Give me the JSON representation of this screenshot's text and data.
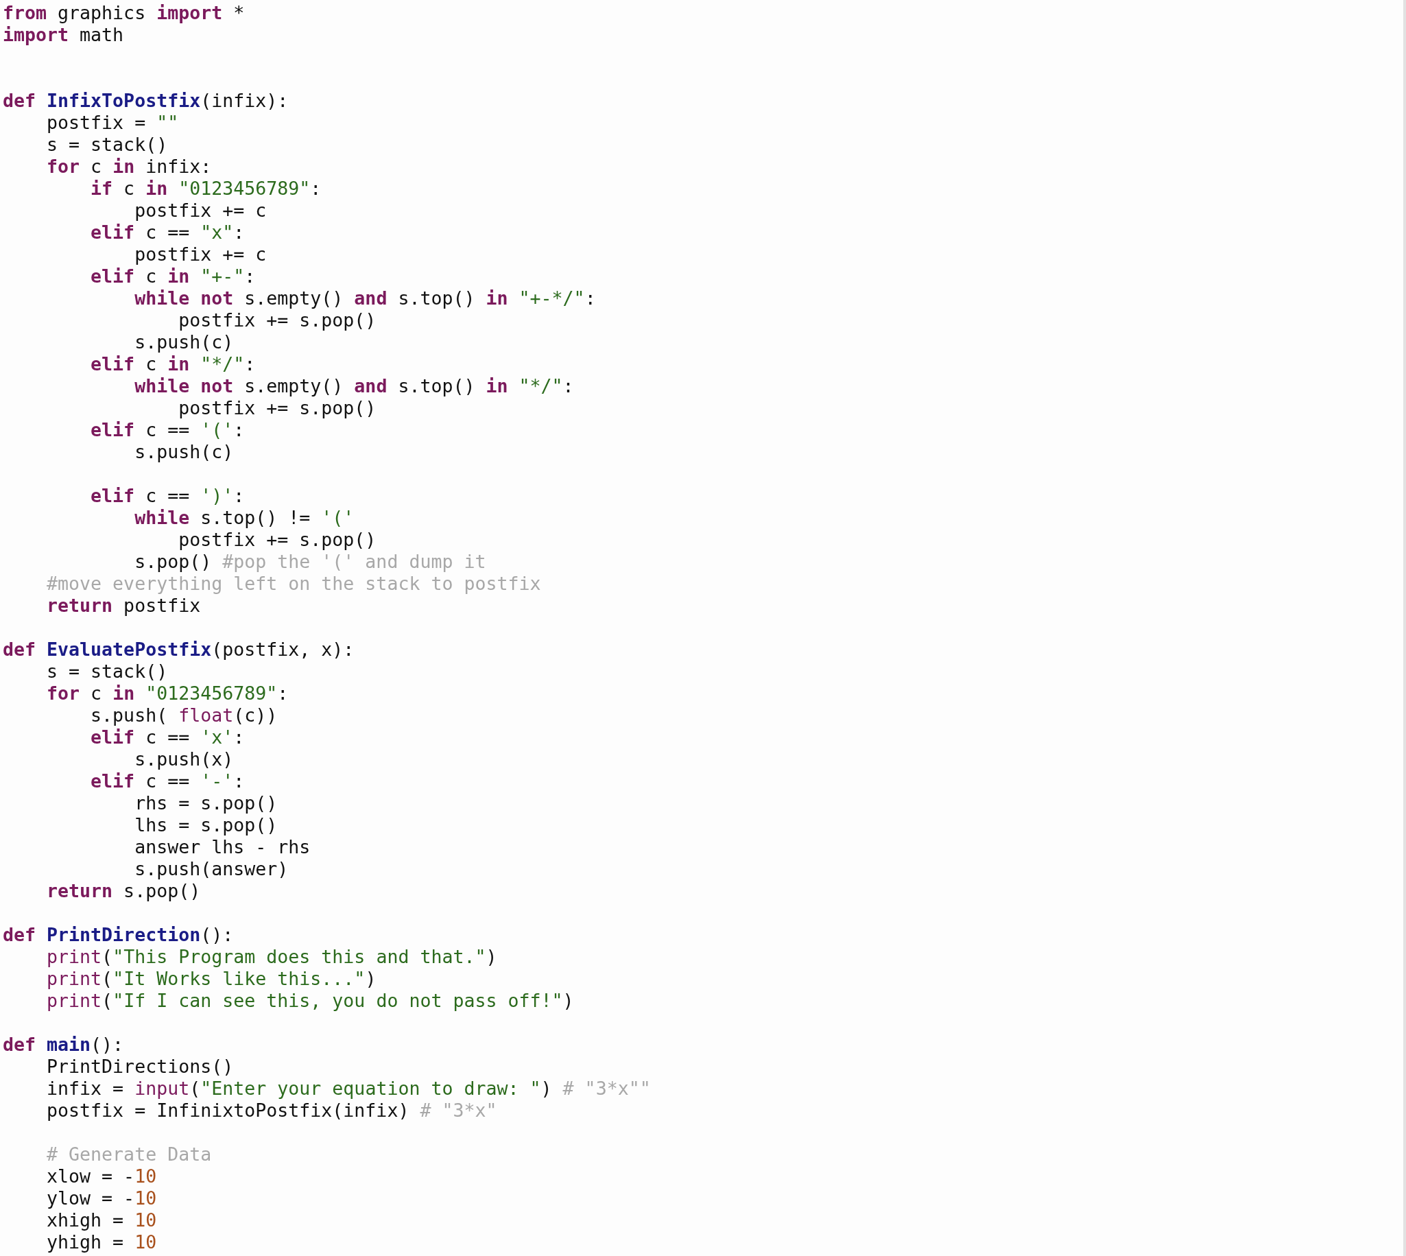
{
  "editor": {
    "lines": [
      {
        "kind": "code",
        "tokens": [
          {
            "kind": "keyword",
            "text": "from"
          },
          {
            "kind": "plain",
            "text": " graphics "
          },
          {
            "kind": "keyword",
            "text": "import"
          },
          {
            "kind": "plain",
            "text": " *"
          }
        ]
      },
      {
        "kind": "code",
        "tokens": [
          {
            "kind": "keyword",
            "text": "import"
          },
          {
            "kind": "plain",
            "text": " math"
          }
        ]
      },
      {
        "kind": "blank"
      },
      {
        "kind": "blank"
      },
      {
        "kind": "code",
        "tokens": [
          {
            "kind": "keyword",
            "text": "def "
          },
          {
            "kind": "function",
            "text": "InfixToPostfix"
          },
          {
            "kind": "plain",
            "text": "(infix):"
          }
        ]
      },
      {
        "kind": "code",
        "tokens": [
          {
            "kind": "plain",
            "text": "    postfix = "
          },
          {
            "kind": "string",
            "text": "\"\""
          }
        ]
      },
      {
        "kind": "code",
        "tokens": [
          {
            "kind": "plain",
            "text": "    s = stack()"
          }
        ]
      },
      {
        "kind": "code",
        "tokens": [
          {
            "kind": "keyword",
            "text": "    for"
          },
          {
            "kind": "plain",
            "text": " c "
          },
          {
            "kind": "keyword",
            "text": "in"
          },
          {
            "kind": "plain",
            "text": " infix:"
          }
        ]
      },
      {
        "kind": "code",
        "tokens": [
          {
            "kind": "keyword",
            "text": "        if"
          },
          {
            "kind": "plain",
            "text": " c "
          },
          {
            "kind": "keyword",
            "text": "in "
          },
          {
            "kind": "string",
            "text": "\"0123456789\""
          },
          {
            "kind": "plain",
            "text": ":"
          }
        ]
      },
      {
        "kind": "code",
        "tokens": [
          {
            "kind": "plain",
            "text": "            postfix += c"
          }
        ]
      },
      {
        "kind": "code",
        "tokens": [
          {
            "kind": "keyword",
            "text": "        elif"
          },
          {
            "kind": "plain",
            "text": " c == "
          },
          {
            "kind": "string",
            "text": "\"x\""
          },
          {
            "kind": "plain",
            "text": ":"
          }
        ]
      },
      {
        "kind": "code",
        "tokens": [
          {
            "kind": "plain",
            "text": "            postfix += c"
          }
        ]
      },
      {
        "kind": "code",
        "tokens": [
          {
            "kind": "keyword",
            "text": "        elif"
          },
          {
            "kind": "plain",
            "text": " c "
          },
          {
            "kind": "keyword",
            "text": "in "
          },
          {
            "kind": "string",
            "text": "\"+-\""
          },
          {
            "kind": "plain",
            "text": ":"
          }
        ]
      },
      {
        "kind": "code",
        "tokens": [
          {
            "kind": "keyword",
            "text": "            while not"
          },
          {
            "kind": "plain",
            "text": " s.empty() "
          },
          {
            "kind": "keyword",
            "text": "and"
          },
          {
            "kind": "plain",
            "text": " s.top() "
          },
          {
            "kind": "keyword",
            "text": "in "
          },
          {
            "kind": "string",
            "text": "\"+-*/\""
          },
          {
            "kind": "plain",
            "text": ":"
          }
        ]
      },
      {
        "kind": "code",
        "tokens": [
          {
            "kind": "plain",
            "text": "                postfix += s.pop()"
          }
        ]
      },
      {
        "kind": "code",
        "tokens": [
          {
            "kind": "plain",
            "text": "            s.push(c)"
          }
        ]
      },
      {
        "kind": "code",
        "tokens": [
          {
            "kind": "keyword",
            "text": "        elif"
          },
          {
            "kind": "plain",
            "text": " c "
          },
          {
            "kind": "keyword",
            "text": "in "
          },
          {
            "kind": "string",
            "text": "\"*/\""
          },
          {
            "kind": "plain",
            "text": ":"
          }
        ]
      },
      {
        "kind": "code",
        "tokens": [
          {
            "kind": "keyword",
            "text": "            while not"
          },
          {
            "kind": "plain",
            "text": " s.empty() "
          },
          {
            "kind": "keyword",
            "text": "and"
          },
          {
            "kind": "plain",
            "text": " s.top() "
          },
          {
            "kind": "keyword",
            "text": "in "
          },
          {
            "kind": "string",
            "text": "\"*/\""
          },
          {
            "kind": "plain",
            "text": ":"
          }
        ]
      },
      {
        "kind": "code",
        "tokens": [
          {
            "kind": "plain",
            "text": "                postfix += s.pop()"
          }
        ]
      },
      {
        "kind": "code",
        "tokens": [
          {
            "kind": "keyword",
            "text": "        elif"
          },
          {
            "kind": "plain",
            "text": " c == "
          },
          {
            "kind": "string",
            "text": "'('"
          },
          {
            "kind": "plain",
            "text": ":"
          }
        ]
      },
      {
        "kind": "code",
        "tokens": [
          {
            "kind": "plain",
            "text": "            s.push(c)"
          }
        ]
      },
      {
        "kind": "blank"
      },
      {
        "kind": "code",
        "tokens": [
          {
            "kind": "keyword",
            "text": "        elif"
          },
          {
            "kind": "plain",
            "text": " c == "
          },
          {
            "kind": "string",
            "text": "')'"
          },
          {
            "kind": "plain",
            "text": ":"
          }
        ]
      },
      {
        "kind": "code",
        "tokens": [
          {
            "kind": "keyword",
            "text": "            while"
          },
          {
            "kind": "plain",
            "text": " s.top() != "
          },
          {
            "kind": "string",
            "text": "'('"
          }
        ]
      },
      {
        "kind": "code",
        "tokens": [
          {
            "kind": "plain",
            "text": "                postfix += s.pop()"
          }
        ]
      },
      {
        "kind": "code",
        "tokens": [
          {
            "kind": "plain",
            "text": "            s.pop() "
          },
          {
            "kind": "comment",
            "text": "#pop the '(' and dump it"
          }
        ]
      },
      {
        "kind": "code",
        "tokens": [
          {
            "kind": "comment",
            "text": "    #move everything left on the stack to postfix"
          }
        ]
      },
      {
        "kind": "code",
        "tokens": [
          {
            "kind": "keyword",
            "text": "    return"
          },
          {
            "kind": "plain",
            "text": " postfix"
          }
        ]
      },
      {
        "kind": "blank"
      },
      {
        "kind": "code",
        "tokens": [
          {
            "kind": "keyword",
            "text": "def "
          },
          {
            "kind": "function",
            "text": "EvaluatePostfix"
          },
          {
            "kind": "plain",
            "text": "(postfix, x):"
          }
        ]
      },
      {
        "kind": "code",
        "tokens": [
          {
            "kind": "plain",
            "text": "    s = stack()"
          }
        ]
      },
      {
        "kind": "code",
        "tokens": [
          {
            "kind": "keyword",
            "text": "    for"
          },
          {
            "kind": "plain",
            "text": " c "
          },
          {
            "kind": "keyword",
            "text": "in "
          },
          {
            "kind": "string",
            "text": "\"0123456789\""
          },
          {
            "kind": "plain",
            "text": ":"
          }
        ]
      },
      {
        "kind": "code",
        "tokens": [
          {
            "kind": "plain",
            "text": "        s.push( "
          },
          {
            "kind": "builtin",
            "text": "float"
          },
          {
            "kind": "plain",
            "text": "(c))"
          }
        ]
      },
      {
        "kind": "code",
        "tokens": [
          {
            "kind": "keyword",
            "text": "        elif"
          },
          {
            "kind": "plain",
            "text": " c == "
          },
          {
            "kind": "string",
            "text": "'x'"
          },
          {
            "kind": "plain",
            "text": ":"
          }
        ]
      },
      {
        "kind": "code",
        "tokens": [
          {
            "kind": "plain",
            "text": "            s.push(x)"
          }
        ]
      },
      {
        "kind": "code",
        "tokens": [
          {
            "kind": "keyword",
            "text": "        elif"
          },
          {
            "kind": "plain",
            "text": " c == "
          },
          {
            "kind": "string",
            "text": "'-'"
          },
          {
            "kind": "plain",
            "text": ":"
          }
        ]
      },
      {
        "kind": "code",
        "tokens": [
          {
            "kind": "plain",
            "text": "            rhs = s.pop()"
          }
        ]
      },
      {
        "kind": "code",
        "tokens": [
          {
            "kind": "plain",
            "text": "            lhs = s.pop()"
          }
        ]
      },
      {
        "kind": "code",
        "tokens": [
          {
            "kind": "plain",
            "text": "            answer lhs - rhs"
          }
        ]
      },
      {
        "kind": "code",
        "tokens": [
          {
            "kind": "plain",
            "text": "            s.push(answer)"
          }
        ]
      },
      {
        "kind": "code",
        "tokens": [
          {
            "kind": "keyword",
            "text": "    return"
          },
          {
            "kind": "plain",
            "text": " s.pop()"
          }
        ]
      },
      {
        "kind": "blank"
      },
      {
        "kind": "code",
        "tokens": [
          {
            "kind": "keyword",
            "text": "def "
          },
          {
            "kind": "function",
            "text": "PrintDirection"
          },
          {
            "kind": "plain",
            "text": "():"
          }
        ]
      },
      {
        "kind": "code",
        "tokens": [
          {
            "kind": "builtin",
            "text": "    print"
          },
          {
            "kind": "plain",
            "text": "("
          },
          {
            "kind": "string",
            "text": "\"This Program does this and that.\""
          },
          {
            "kind": "plain",
            "text": ")"
          }
        ]
      },
      {
        "kind": "code",
        "tokens": [
          {
            "kind": "builtin",
            "text": "    print"
          },
          {
            "kind": "plain",
            "text": "("
          },
          {
            "kind": "string",
            "text": "\"It Works like this...\""
          },
          {
            "kind": "plain",
            "text": ")"
          }
        ]
      },
      {
        "kind": "code",
        "tokens": [
          {
            "kind": "builtin",
            "text": "    print"
          },
          {
            "kind": "plain",
            "text": "("
          },
          {
            "kind": "string",
            "text": "\"If I can see this, you do not pass off!\""
          },
          {
            "kind": "plain",
            "text": ")"
          }
        ]
      },
      {
        "kind": "blank"
      },
      {
        "kind": "code",
        "tokens": [
          {
            "kind": "keyword",
            "text": "def "
          },
          {
            "kind": "function",
            "text": "main"
          },
          {
            "kind": "plain",
            "text": "():"
          }
        ]
      },
      {
        "kind": "code",
        "tokens": [
          {
            "kind": "plain",
            "text": "    PrintDirections()"
          }
        ]
      },
      {
        "kind": "code",
        "tokens": [
          {
            "kind": "plain",
            "text": "    infix = "
          },
          {
            "kind": "builtin",
            "text": "input"
          },
          {
            "kind": "plain",
            "text": "("
          },
          {
            "kind": "string",
            "text": "\"Enter your equation to draw: \""
          },
          {
            "kind": "plain",
            "text": ") "
          },
          {
            "kind": "comment",
            "text": "# \"3*x\"\""
          }
        ]
      },
      {
        "kind": "code",
        "tokens": [
          {
            "kind": "plain",
            "text": "    postfix = InfinixtoPostfix(infix) "
          },
          {
            "kind": "comment",
            "text": "# \"3*x\""
          }
        ]
      },
      {
        "kind": "blank"
      },
      {
        "kind": "code",
        "tokens": [
          {
            "kind": "comment",
            "text": "    # Generate Data"
          }
        ]
      },
      {
        "kind": "code",
        "tokens": [
          {
            "kind": "plain",
            "text": "    xlow = -"
          },
          {
            "kind": "number",
            "text": "10"
          }
        ]
      },
      {
        "kind": "code",
        "tokens": [
          {
            "kind": "plain",
            "text": "    ylow = -"
          },
          {
            "kind": "number",
            "text": "10"
          }
        ]
      },
      {
        "kind": "code",
        "tokens": [
          {
            "kind": "plain",
            "text": "    xhigh = "
          },
          {
            "kind": "number",
            "text": "10"
          }
        ]
      },
      {
        "kind": "code",
        "tokens": [
          {
            "kind": "plain",
            "text": "    yhigh = "
          },
          {
            "kind": "number",
            "text": "10"
          }
        ]
      }
    ]
  }
}
